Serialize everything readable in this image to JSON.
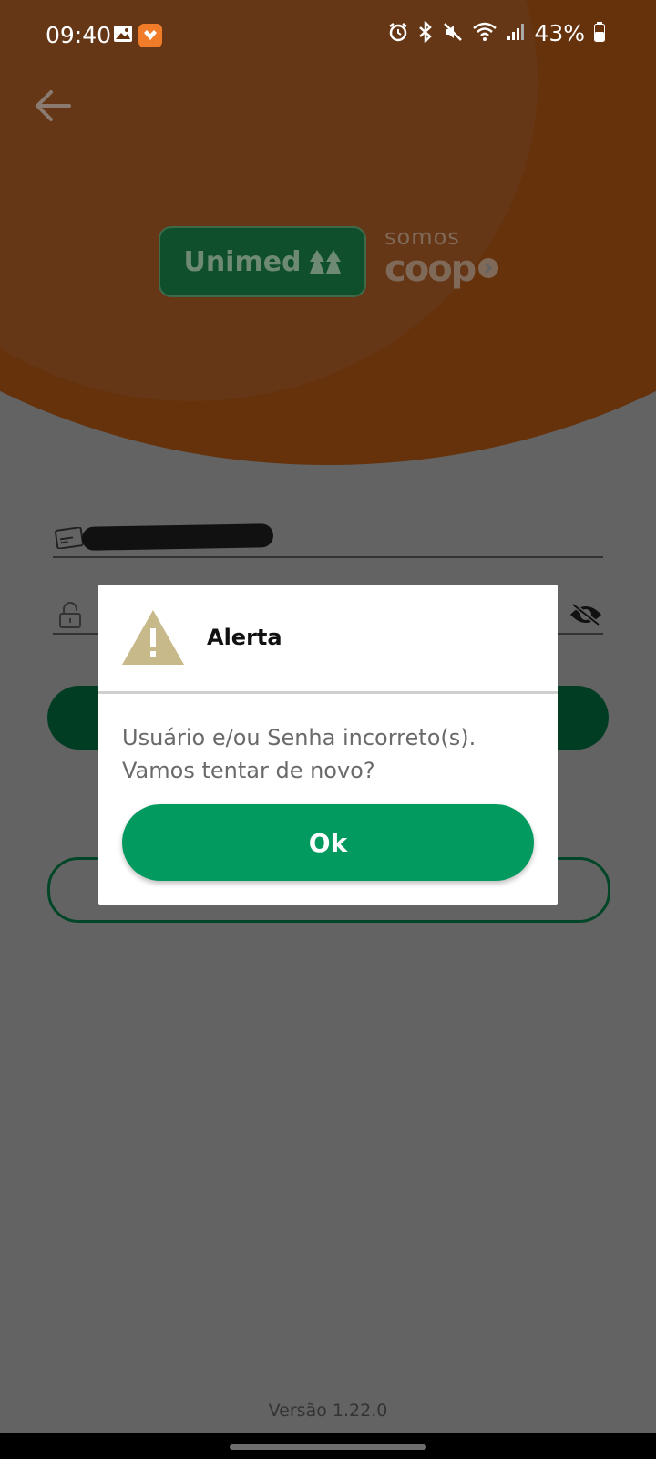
{
  "status_bar": {
    "time": "09:40",
    "battery": "43%",
    "icons": [
      "gallery-icon",
      "app-notification-icon",
      "alarm-icon",
      "bluetooth-icon",
      "mute-icon",
      "wifi-icon",
      "signal-icon",
      "battery-icon"
    ]
  },
  "header": {
    "back_icon": "arrow-left-icon",
    "logo_unimed": "Unimed",
    "logo_coop_top": "somos",
    "logo_coop_bottom": "coop"
  },
  "form": {
    "user_icon": "card-icon",
    "password_icon": "lock-icon",
    "visibility_icon": "eye-off-icon"
  },
  "dialog": {
    "icon": "warning-icon",
    "title": "Alerta",
    "message": "Usuário e/ou Senha incorreto(s).\nVamos tentar de novo?",
    "ok_label": "Ok"
  },
  "footer": {
    "version": "Versão 1.22.0"
  },
  "colors": {
    "dim_background": "#636363",
    "header_brown": "#65320c",
    "brand_green": "#039a5f",
    "warning_tan": "#c8b98a"
  }
}
